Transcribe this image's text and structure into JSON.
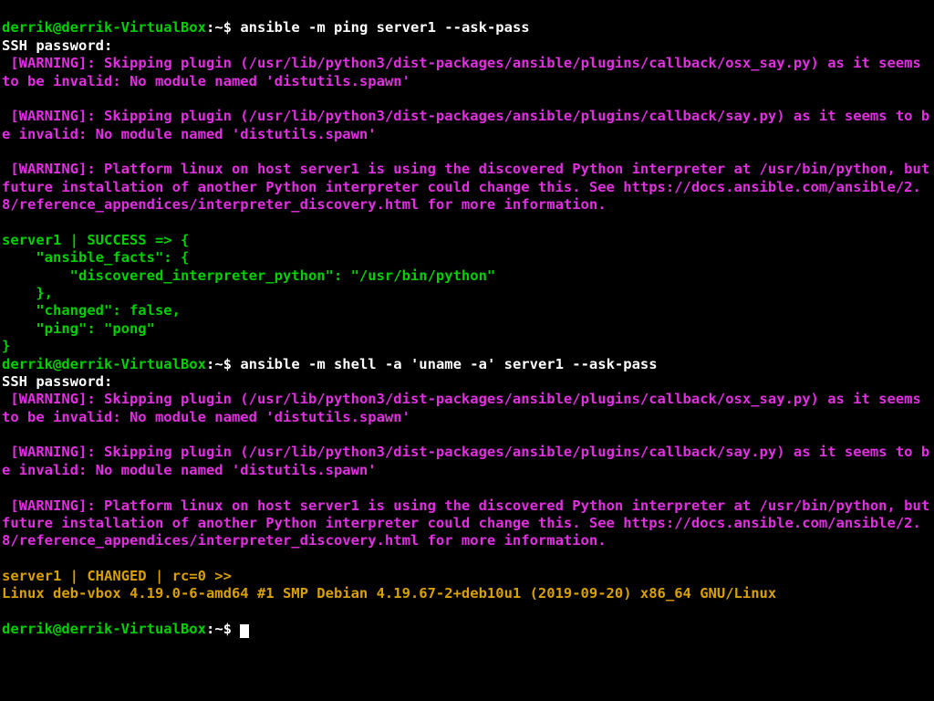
{
  "prompt": {
    "user_host": "derrik@derrik-VirtualBox",
    "sep1": ":",
    "path": "~",
    "sep2": "$ "
  },
  "cmd1": "ansible -m ping server1 --ask-pass",
  "ssh_pw": "SSH password:",
  "warn_osx_say": "[WARNING]: Skipping plugin (/usr/lib/python3/dist-packages/ansible/plugins/callback/osx_say.py) as it seems to be invalid: No module named 'distutils.spawn'",
  "warn_say": "[WARNING]: Skipping plugin (/usr/lib/python3/dist-packages/ansible/plugins/callback/say.py) as it seems to be invalid: No module named 'distutils.spawn'",
  "warn_interp": "[WARNING]: Platform linux on host server1 is using the discovered Python interpreter at /usr/bin/python, but future installation of another Python interpreter could change this. See https://docs.ansible.com/ansible/2.8/reference_appendices/interpreter_discovery.html for more information.",
  "success_block": "server1 | SUCCESS => {\n    \"ansible_facts\": {\n        \"discovered_interpreter_python\": \"/usr/bin/python\"\n    },\n    \"changed\": false,\n    \"ping\": \"pong\"\n}",
  "cmd2": "ansible -m shell -a 'uname -a' server1 --ask-pass",
  "changed_header": "server1 | CHANGED | rc=0 >>",
  "uname_output": "Linux deb-vbox 4.19.0-6-amd64 #1 SMP Debian 4.19.67-2+deb10u1 (2019-09-20) x86_64 GNU/Linux"
}
